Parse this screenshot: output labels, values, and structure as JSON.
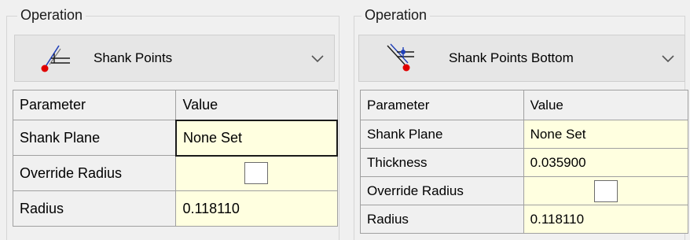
{
  "left": {
    "group_title": "Operation",
    "operation": {
      "label": "Shank Points",
      "icon": "shank-points-icon"
    },
    "grid": {
      "headers": [
        "Parameter",
        "Value"
      ],
      "rows": [
        {
          "name": "Shank Plane",
          "value": "None Set",
          "type": "text"
        },
        {
          "name": "Override Radius",
          "value": false,
          "type": "checkbox"
        },
        {
          "name": "Radius",
          "value": "0.118110",
          "type": "text"
        }
      ]
    }
  },
  "right": {
    "group_title": "Operation",
    "operation": {
      "label": "Shank Points Bottom",
      "icon": "shank-points-bottom-icon"
    },
    "grid": {
      "headers": [
        "Parameter",
        "Value"
      ],
      "rows": [
        {
          "name": "Shank Plane",
          "value": "None Set",
          "type": "text"
        },
        {
          "name": "Thickness",
          "value": "0.035900",
          "type": "text"
        },
        {
          "name": "Override Radius",
          "value": false,
          "type": "checkbox"
        },
        {
          "name": "Radius",
          "value": "0.118110",
          "type": "text"
        }
      ]
    }
  },
  "colors": {
    "value_cell_bg": "#ffffe0",
    "point_red": "#e00000",
    "axis_blue": "#1f3fb8"
  }
}
